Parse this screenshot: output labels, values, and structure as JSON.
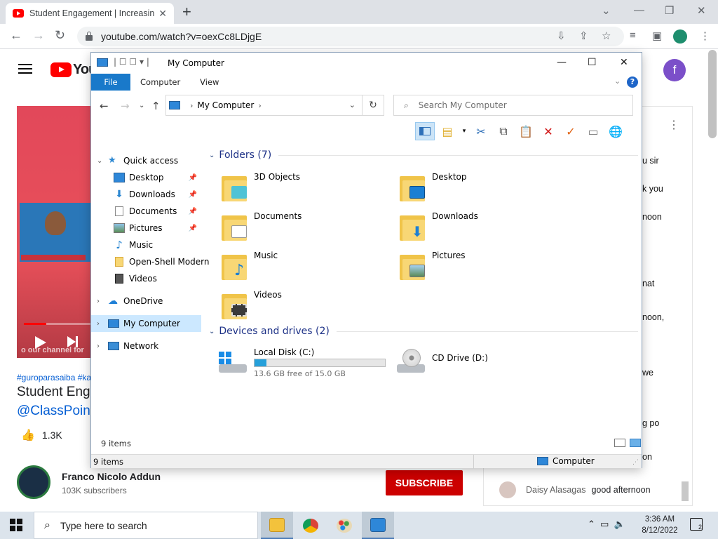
{
  "browser": {
    "tab_title": "Student Engagement | Increasing",
    "tab_close": "✕",
    "new_tab": "+",
    "url": "youtube.com/watch?v=oexCc8LDjgE",
    "minimize": "⌄",
    "minimize_win": "—",
    "restore": "❐",
    "close": "✕"
  },
  "youtube": {
    "logo_text": "You",
    "avatar_letter": "f",
    "video_overlay": "o our channel for",
    "hashtags": "#guroparasaiba #ka",
    "video_title": "Student Enga",
    "video_title_link": "@ClassPoint",
    "likes": "1.3K",
    "channel_name": "Franco Nicolo Addun",
    "channel_subs": "103K subscribers",
    "subscribe_label": "SUBSCRIBE",
    "chat_fragments": [
      "u sir",
      "k you",
      "noon",
      "nat",
      "noon,",
      "we",
      "g po",
      "on"
    ],
    "chat_last": {
      "user": "Daisy Alasagas",
      "message": "good afternoon"
    }
  },
  "explorer": {
    "title": "My Computer",
    "ribbon_tabs": [
      "File",
      "Computer",
      "View"
    ],
    "help": "?",
    "address": "My Computer",
    "search_placeholder": "Search My Computer",
    "nav": {
      "quick_access": "Quick access",
      "quick_items": [
        "Desktop",
        "Downloads",
        "Documents",
        "Pictures",
        "Music",
        "Open-Shell Modern",
        "Videos"
      ],
      "onedrive": "OneDrive",
      "my_computer": "My Computer",
      "network": "Network"
    },
    "folders_header": "Folders (7)",
    "folders": [
      "3D Objects",
      "Desktop",
      "Documents",
      "Downloads",
      "Music",
      "Pictures",
      "Videos"
    ],
    "drives_header": "Devices and drives (2)",
    "drives": [
      {
        "name": "Local Disk (C:)",
        "free": "13.6 GB free of 15.0 GB",
        "used_fraction": 0.09
      },
      {
        "name": "CD Drive (D:)"
      }
    ],
    "status_count": "9 items",
    "bottom_count": "9 items",
    "bottom_location": "Computer"
  },
  "taskbar": {
    "search_placeholder": "Type here to search",
    "time": "3:36 AM",
    "date": "8/12/2022",
    "notification_count": "2"
  }
}
